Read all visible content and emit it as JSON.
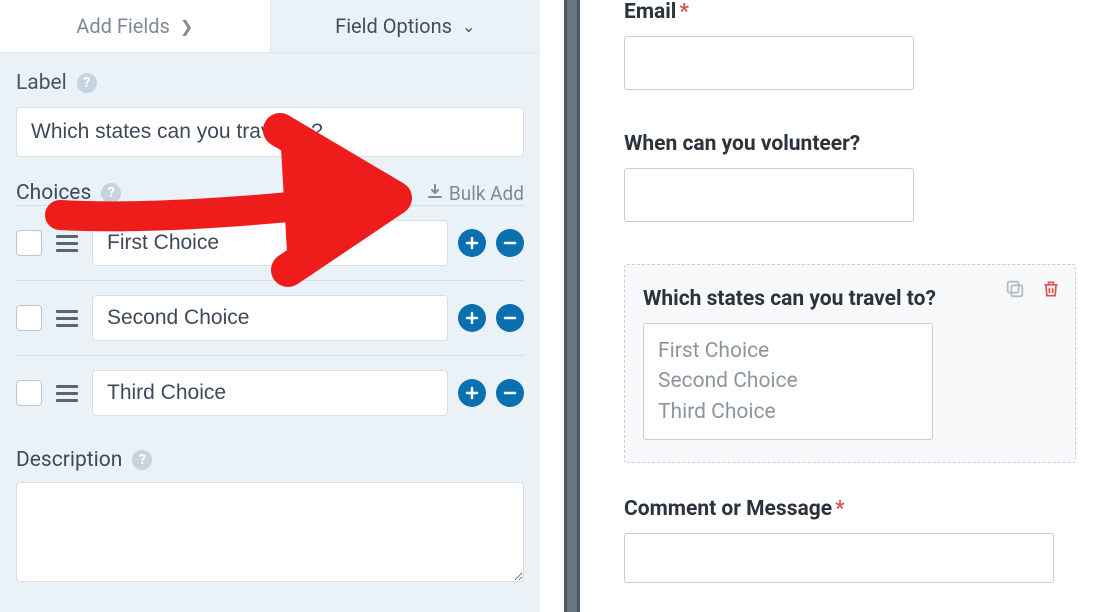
{
  "tabs": {
    "add_fields": "Add Fields",
    "field_options": "Field Options"
  },
  "panel": {
    "label_label": "Label",
    "label_value": "Which states can you travel to?",
    "choices_label": "Choices",
    "bulk_add": "Bulk Add",
    "choices": [
      {
        "value": "First Choice"
      },
      {
        "value": "Second Choice"
      },
      {
        "value": "Third Choice"
      }
    ],
    "description_label": "Description"
  },
  "preview": {
    "email_label": "Email",
    "volunteer_label": "When can you volunteer?",
    "states_label": "Which states can you travel to?",
    "states_options": [
      "First Choice",
      "Second Choice",
      "Third Choice"
    ],
    "comment_label": "Comment or Message"
  }
}
